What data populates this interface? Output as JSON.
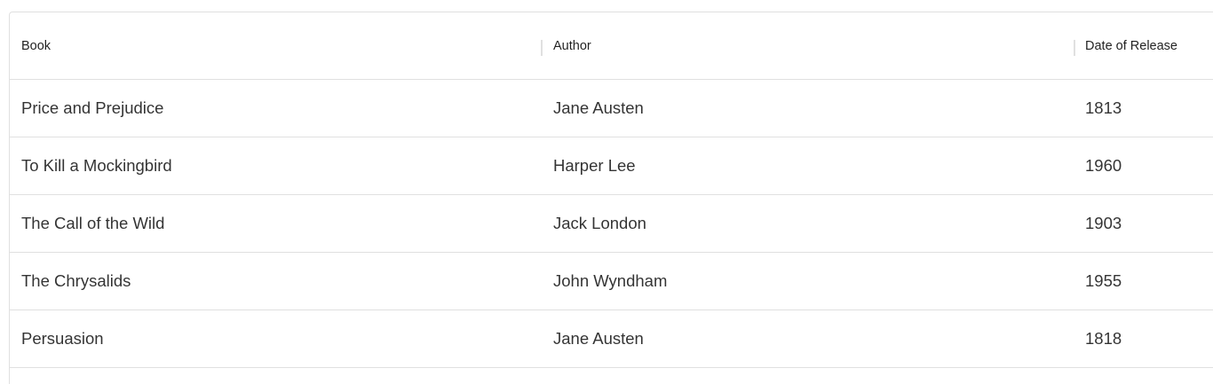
{
  "table": {
    "columns": [
      "Book",
      "Author",
      "Date of Release"
    ],
    "rows": [
      [
        "Price and Prejudice",
        "Jane Austen",
        "1813"
      ],
      [
        "To Kill a Mockingbird",
        "Harper Lee",
        "1960"
      ],
      [
        "The Call of the Wild",
        "Jack London",
        "1903"
      ],
      [
        "The Chrysalids",
        "John Wyndham",
        "1955"
      ],
      [
        "Persuasion",
        "Jane Austen",
        "1818"
      ]
    ]
  }
}
